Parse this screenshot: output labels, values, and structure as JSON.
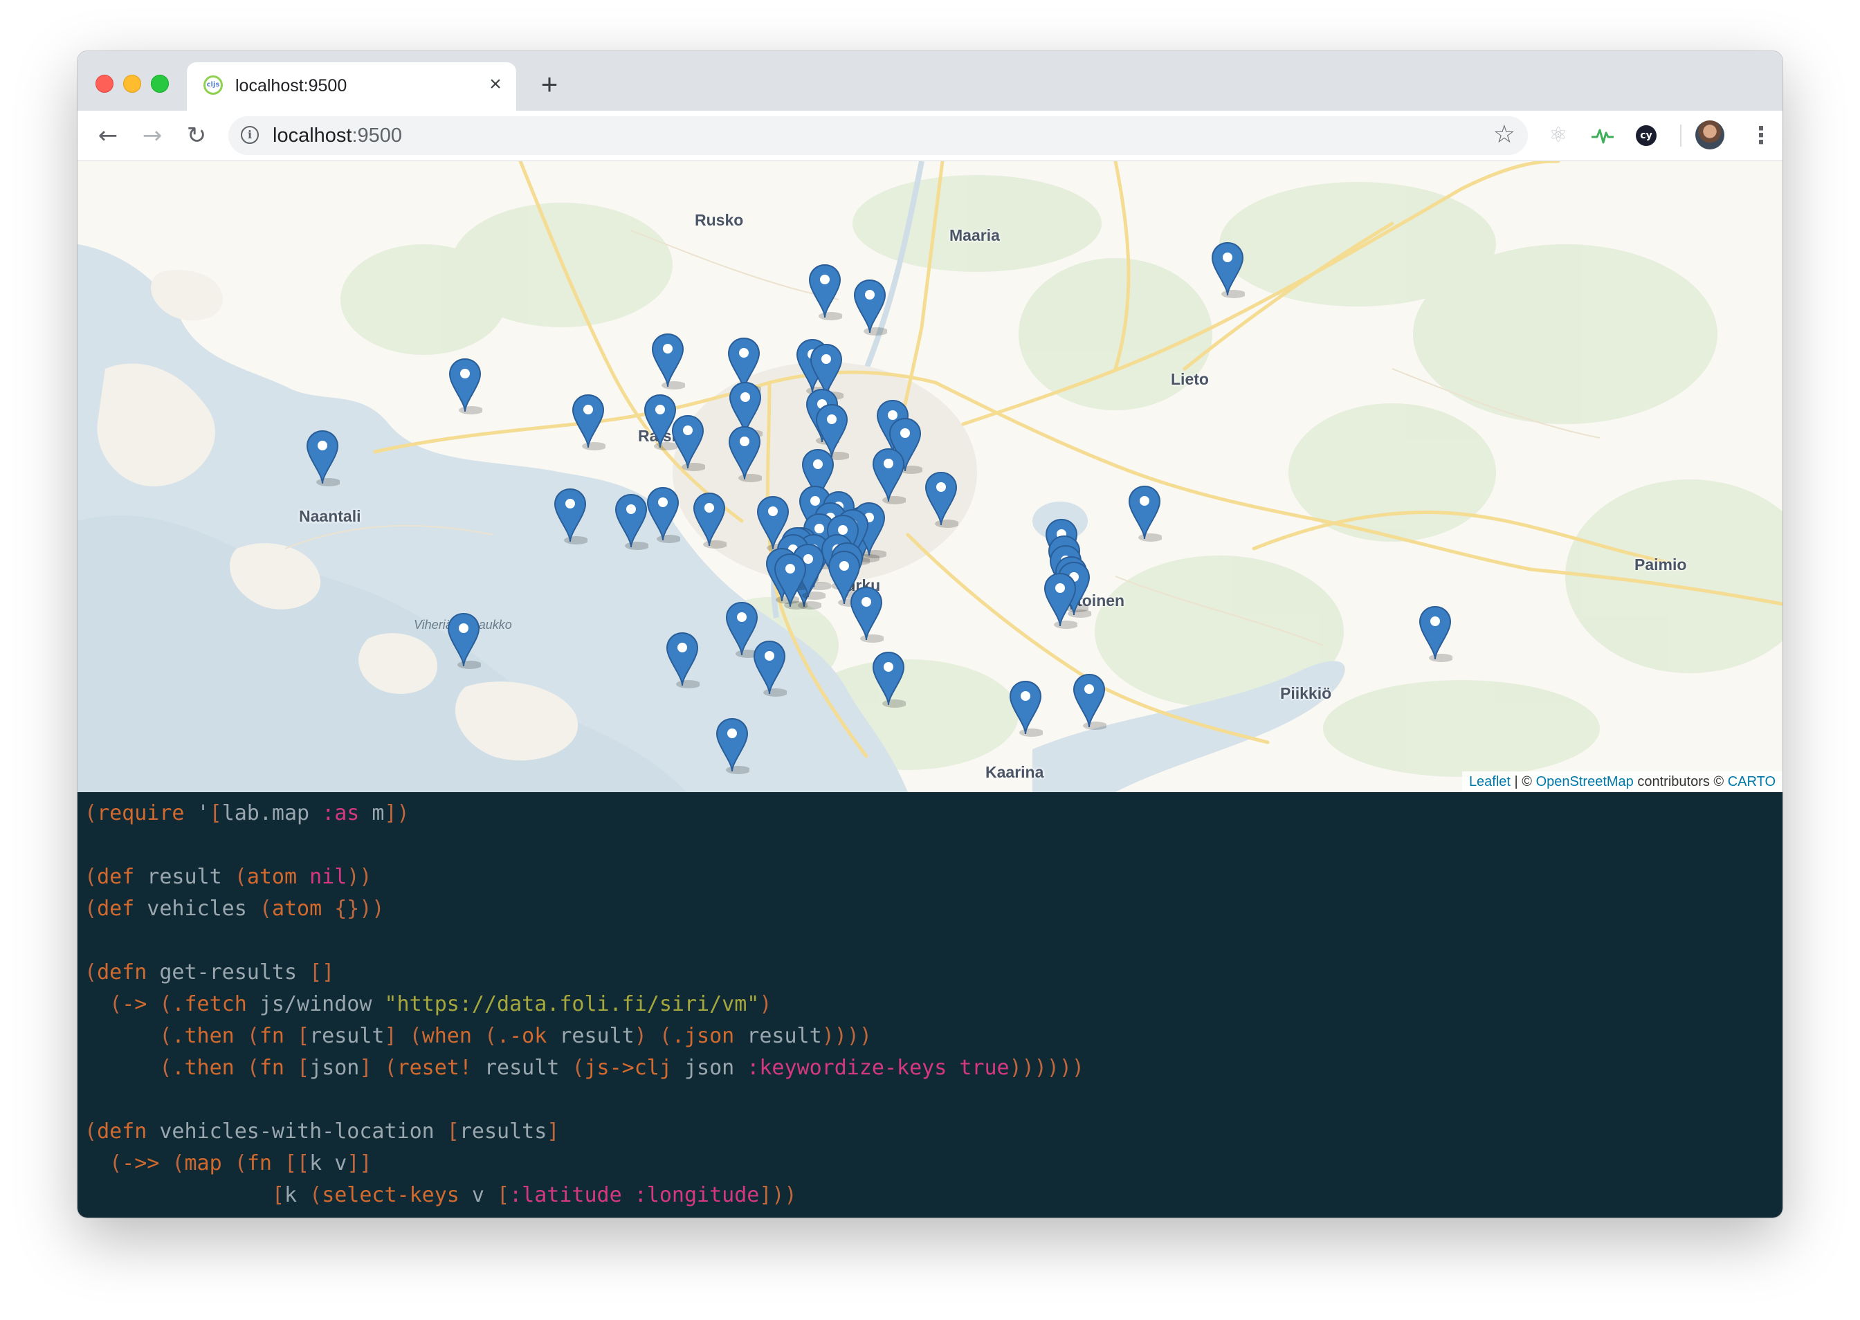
{
  "browser": {
    "tab": {
      "title": "localhost:9500",
      "favicon": "cljs-favicon-icon"
    },
    "address_bar": {
      "host": "localhost",
      "port": ":9500"
    },
    "extensions": [
      "react-devtools-icon",
      "pulse-extension-icon",
      "cypress-extension-icon"
    ]
  },
  "map": {
    "places": [
      {
        "name": "Rusko"
      },
      {
        "name": "Maaria"
      },
      {
        "name": "Lieto"
      },
      {
        "name": "Naantali"
      },
      {
        "name": "Raisio"
      },
      {
        "name": "Littoinen"
      },
      {
        "name": "Paimio"
      },
      {
        "name": "Piikkiö"
      },
      {
        "name": "Kaarina"
      },
      {
        "name": "Turku"
      }
    ],
    "water_label": "Viheriäistenaukko",
    "marker_color": "#3a7fc4",
    "attribution": {
      "leaflet": "Leaflet",
      "sep": " | © ",
      "osm": "OpenStreetMap",
      "contrib": " contributors © ",
      "carto": "CARTO"
    }
  },
  "code": {
    "lines": [
      [
        [
          "p",
          "("
        ],
        [
          "k",
          "require"
        ],
        [
          "s",
          " '"
        ],
        [
          "p",
          "["
        ],
        [
          "s",
          "lab.map "
        ],
        [
          "key",
          ":as"
        ],
        [
          "s",
          " m"
        ],
        [
          "p",
          "])"
        ]
      ],
      [],
      [
        [
          "p",
          "("
        ],
        [
          "k",
          "def"
        ],
        [
          "s",
          " result "
        ],
        [
          "p",
          "("
        ],
        [
          "k",
          "atom"
        ],
        [
          "s",
          " "
        ],
        [
          "key",
          "nil"
        ],
        [
          "p",
          "))"
        ]
      ],
      [
        [
          "p",
          "("
        ],
        [
          "k",
          "def"
        ],
        [
          "s",
          " vehicles "
        ],
        [
          "p",
          "("
        ],
        [
          "k",
          "atom"
        ],
        [
          "s",
          " "
        ],
        [
          "p",
          "{}))"
        ]
      ],
      [],
      [
        [
          "p",
          "("
        ],
        [
          "k",
          "defn"
        ],
        [
          "s",
          " get-results "
        ],
        [
          "p",
          "[]"
        ]
      ],
      [
        [
          "s",
          "  "
        ],
        [
          "p",
          "("
        ],
        [
          "k",
          "->"
        ],
        [
          "s",
          " "
        ],
        [
          "p",
          "("
        ],
        [
          "k",
          ".fetch"
        ],
        [
          "s",
          " js/window "
        ],
        [
          "str",
          "\"https://data.foli.fi/siri/vm\""
        ],
        [
          "p",
          ")"
        ]
      ],
      [
        [
          "s",
          "      "
        ],
        [
          "p",
          "("
        ],
        [
          "k",
          ".then"
        ],
        [
          "s",
          " "
        ],
        [
          "p",
          "("
        ],
        [
          "k",
          "fn"
        ],
        [
          "s",
          " "
        ],
        [
          "p",
          "["
        ],
        [
          "s",
          "result"
        ],
        [
          "p",
          "]"
        ],
        [
          "s",
          " "
        ],
        [
          "p",
          "("
        ],
        [
          "k",
          "when"
        ],
        [
          "s",
          " "
        ],
        [
          "p",
          "("
        ],
        [
          "k",
          ".-ok"
        ],
        [
          "s",
          " result"
        ],
        [
          "p",
          ")"
        ],
        [
          "s",
          " "
        ],
        [
          "p",
          "("
        ],
        [
          "k",
          ".json"
        ],
        [
          "s",
          " result"
        ],
        [
          "p",
          "))))"
        ]
      ],
      [
        [
          "s",
          "      "
        ],
        [
          "p",
          "("
        ],
        [
          "k",
          ".then"
        ],
        [
          "s",
          " "
        ],
        [
          "p",
          "("
        ],
        [
          "k",
          "fn"
        ],
        [
          "s",
          " "
        ],
        [
          "p",
          "["
        ],
        [
          "s",
          "json"
        ],
        [
          "p",
          "]"
        ],
        [
          "s",
          " "
        ],
        [
          "p",
          "("
        ],
        [
          "k",
          "reset!"
        ],
        [
          "s",
          " result "
        ],
        [
          "p",
          "("
        ],
        [
          "k",
          "js->clj"
        ],
        [
          "s",
          " json "
        ],
        [
          "key",
          ":keywordize-keys"
        ],
        [
          "s",
          " "
        ],
        [
          "key",
          "true"
        ],
        [
          "p",
          "))))))"
        ]
      ],
      [],
      [
        [
          "p",
          "("
        ],
        [
          "k",
          "defn"
        ],
        [
          "s",
          " vehicles-with-location "
        ],
        [
          "p",
          "["
        ],
        [
          "s",
          "results"
        ],
        [
          "p",
          "]"
        ]
      ],
      [
        [
          "s",
          "  "
        ],
        [
          "p",
          "("
        ],
        [
          "k",
          "->>"
        ],
        [
          "s",
          " "
        ],
        [
          "p",
          "("
        ],
        [
          "k",
          "map"
        ],
        [
          "s",
          " "
        ],
        [
          "p",
          "("
        ],
        [
          "k",
          "fn"
        ],
        [
          "s",
          " "
        ],
        [
          "p",
          "[["
        ],
        [
          "s",
          "k v"
        ],
        [
          "p",
          "]]"
        ]
      ],
      [
        [
          "s",
          "               "
        ],
        [
          "p",
          "["
        ],
        [
          "s",
          "k "
        ],
        [
          "p",
          "("
        ],
        [
          "k",
          "select-keys"
        ],
        [
          "s",
          " v "
        ],
        [
          "p",
          "["
        ],
        [
          "key",
          ":latitude"
        ],
        [
          "s",
          " "
        ],
        [
          "key",
          ":longitude"
        ],
        [
          "p",
          "]))"
        ]
      ]
    ]
  }
}
